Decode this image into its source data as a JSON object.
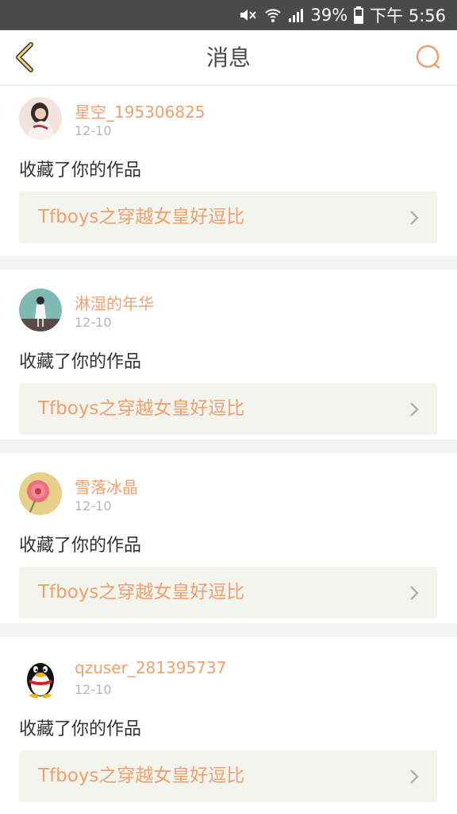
{
  "status_bar": {
    "battery_percent": "39%",
    "time": "下午 5:56",
    "icons": [
      "mute-icon",
      "wifi-icon",
      "signal-icon",
      "battery-icon"
    ]
  },
  "header": {
    "title": "消息",
    "back_icon": "chevron-left-icon",
    "search_icon": "search-icon"
  },
  "colors": {
    "accent": "#f0a06e",
    "status_bar_bg": "#4a4a4a",
    "box_bg": "#f4f4ee"
  },
  "messages": [
    {
      "username": "星空_195306825",
      "date": "12-10",
      "action": "收藏了你的作品",
      "work_title": "Tfboys之穿越女皇好逗比"
    },
    {
      "username": "淋湿的年华",
      "date": "12-10",
      "action": "收藏了你的作品",
      "work_title": "Tfboys之穿越女皇好逗比"
    },
    {
      "username": "雪落冰晶",
      "date": "12-10",
      "action": "收藏了你的作品",
      "work_title": "Tfboys之穿越女皇好逗比"
    },
    {
      "username": "qzuser_281395737",
      "date": "12-10",
      "action": "收藏了你的作品",
      "work_title": "Tfboys之穿越女皇好逗比"
    }
  ]
}
